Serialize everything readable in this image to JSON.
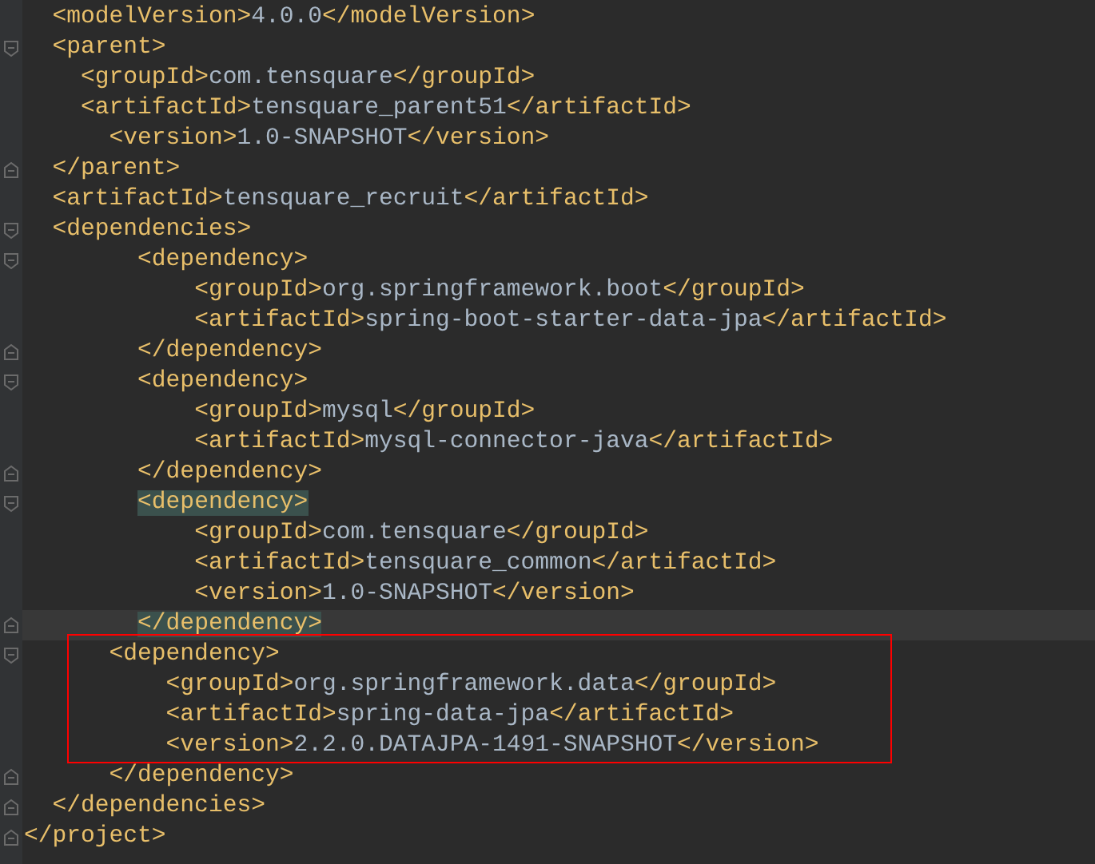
{
  "editor": {
    "lines": [
      {
        "text": "  <modelVersion>4.0.0</modelVersion>",
        "kind": "plain",
        "tag_match": false,
        "current": false,
        "in_box": false
      },
      {
        "text": "  <parent>",
        "kind": "open",
        "tag_match": false,
        "current": false,
        "in_box": false
      },
      {
        "text": "    <groupId>com.tensquare</groupId>",
        "kind": "plain",
        "tag_match": false,
        "current": false,
        "in_box": false
      },
      {
        "text": "    <artifactId>tensquare_parent51</artifactId>",
        "kind": "plain",
        "tag_match": false,
        "current": false,
        "in_box": false
      },
      {
        "text": "      <version>1.0-SNAPSHOT</version>",
        "kind": "plain",
        "tag_match": false,
        "current": false,
        "in_box": false
      },
      {
        "text": "  </parent>",
        "kind": "close",
        "tag_match": false,
        "current": false,
        "in_box": false
      },
      {
        "text": "  <artifactId>tensquare_recruit</artifactId>",
        "kind": "plain",
        "tag_match": false,
        "current": false,
        "in_box": false
      },
      {
        "text": "  <dependencies>",
        "kind": "open",
        "tag_match": false,
        "current": false,
        "in_box": false
      },
      {
        "text": "        <dependency>",
        "kind": "open",
        "tag_match": false,
        "current": false,
        "in_box": false
      },
      {
        "text": "            <groupId>org.springframework.boot</groupId>",
        "kind": "plain",
        "tag_match": false,
        "current": false,
        "in_box": false
      },
      {
        "text": "            <artifactId>spring-boot-starter-data-jpa</artifactId>",
        "kind": "plain",
        "tag_match": false,
        "current": false,
        "in_box": false
      },
      {
        "text": "        </dependency>",
        "kind": "close",
        "tag_match": false,
        "current": false,
        "in_box": false
      },
      {
        "text": "        <dependency>",
        "kind": "open",
        "tag_match": false,
        "current": false,
        "in_box": false
      },
      {
        "text": "            <groupId>mysql</groupId>",
        "kind": "plain",
        "tag_match": false,
        "current": false,
        "in_box": false
      },
      {
        "text": "            <artifactId>mysql-connector-java</artifactId>",
        "kind": "plain",
        "tag_match": false,
        "current": false,
        "in_box": false
      },
      {
        "text": "        </dependency>",
        "kind": "close",
        "tag_match": false,
        "current": false,
        "in_box": false
      },
      {
        "text": "        <dependency>",
        "kind": "open",
        "tag_match": true,
        "current": false,
        "in_box": false
      },
      {
        "text": "            <groupId>com.tensquare</groupId>",
        "kind": "plain",
        "tag_match": false,
        "current": false,
        "in_box": false
      },
      {
        "text": "            <artifactId>tensquare_common</artifactId>",
        "kind": "plain",
        "tag_match": false,
        "current": false,
        "in_box": false
      },
      {
        "text": "            <version>1.0-SNAPSHOT</version>",
        "kind": "plain",
        "tag_match": false,
        "current": false,
        "in_box": false
      },
      {
        "text": "        </dependency>",
        "kind": "close",
        "tag_match": true,
        "current": true,
        "in_box": false
      },
      {
        "text": "      <dependency>",
        "kind": "open",
        "tag_match": false,
        "current": false,
        "in_box": true
      },
      {
        "text": "          <groupId>org.springframework.data</groupId>",
        "kind": "plain",
        "tag_match": false,
        "current": false,
        "in_box": true
      },
      {
        "text": "          <artifactId>spring-data-jpa</artifactId>",
        "kind": "plain",
        "tag_match": false,
        "current": false,
        "in_box": true
      },
      {
        "text": "          <version>2.2.0.DATAJPA-1491-SNAPSHOT</version>",
        "kind": "plain",
        "tag_match": false,
        "current": false,
        "in_box": true
      },
      {
        "text": "      </dependency>",
        "kind": "close",
        "tag_match": false,
        "current": false,
        "in_box": false
      },
      {
        "text": "  </dependencies>",
        "kind": "close",
        "tag_match": false,
        "current": false,
        "in_box": false
      },
      {
        "text": "</project>",
        "kind": "close",
        "tag_match": false,
        "current": false,
        "in_box": false
      }
    ]
  }
}
